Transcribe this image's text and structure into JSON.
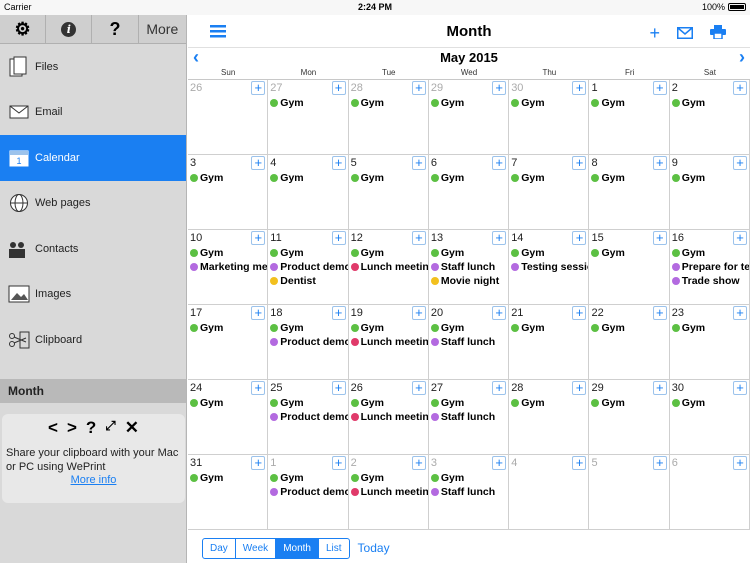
{
  "status": {
    "carrier": "Carrier",
    "time": "2:24 PM",
    "battery": "100%"
  },
  "sidebar": {
    "toolbar": {
      "more_label": "More"
    },
    "items": [
      {
        "label": "Files",
        "icon": "files-icon"
      },
      {
        "label": "Email",
        "icon": "email-icon"
      },
      {
        "label": "Calendar",
        "icon": "calendar-icon"
      },
      {
        "label": "Web pages",
        "icon": "globe-icon"
      },
      {
        "label": "Contacts",
        "icon": "contacts-icon"
      },
      {
        "label": "Images",
        "icon": "images-icon"
      },
      {
        "label": "Clipboard",
        "icon": "clipboard-icon"
      }
    ],
    "active_index": 2,
    "section_header": "Month",
    "clipboard_panel": {
      "text": "Share your clipboard with your Mac or PC using WePrint",
      "link": "More info"
    }
  },
  "header": {
    "title": "Month",
    "month_label": "May 2015"
  },
  "weekdays": [
    "Sun",
    "Mon",
    "Tue",
    "Wed",
    "Thu",
    "Fri",
    "Sat"
  ],
  "colors": {
    "accent": "#1a7ff2",
    "gym": "#5cc043",
    "purple": "#b36ae0",
    "red": "#e03a6a",
    "yellow": "#f2c01e"
  },
  "calendar": {
    "weeks": [
      [
        {
          "day": "26",
          "other": true,
          "events": []
        },
        {
          "day": "27",
          "other": true,
          "events": [
            {
              "t": "Gym",
              "c": "gym"
            }
          ]
        },
        {
          "day": "28",
          "other": true,
          "events": [
            {
              "t": "Gym",
              "c": "gym"
            }
          ]
        },
        {
          "day": "29",
          "other": true,
          "events": [
            {
              "t": "Gym",
              "c": "gym"
            }
          ]
        },
        {
          "day": "30",
          "other": true,
          "events": [
            {
              "t": "Gym",
              "c": "gym"
            }
          ]
        },
        {
          "day": "1",
          "other": false,
          "events": [
            {
              "t": "Gym",
              "c": "gym"
            }
          ]
        },
        {
          "day": "2",
          "other": false,
          "events": [
            {
              "t": "Gym",
              "c": "gym"
            }
          ]
        }
      ],
      [
        {
          "day": "3",
          "events": [
            {
              "t": "Gym",
              "c": "gym"
            }
          ]
        },
        {
          "day": "4",
          "events": [
            {
              "t": "Gym",
              "c": "gym"
            }
          ]
        },
        {
          "day": "5",
          "events": [
            {
              "t": "Gym",
              "c": "gym"
            }
          ]
        },
        {
          "day": "6",
          "events": [
            {
              "t": "Gym",
              "c": "gym"
            }
          ]
        },
        {
          "day": "7",
          "events": [
            {
              "t": "Gym",
              "c": "gym"
            }
          ]
        },
        {
          "day": "8",
          "events": [
            {
              "t": "Gym",
              "c": "gym"
            }
          ]
        },
        {
          "day": "9",
          "events": [
            {
              "t": "Gym",
              "c": "gym"
            }
          ]
        }
      ],
      [
        {
          "day": "10",
          "events": [
            {
              "t": "Gym",
              "c": "gym"
            },
            {
              "t": "Marketing me",
              "c": "purple"
            }
          ]
        },
        {
          "day": "11",
          "events": [
            {
              "t": "Gym",
              "c": "gym"
            },
            {
              "t": "Product demo",
              "c": "purple"
            },
            {
              "t": "Dentist",
              "c": "yellow"
            }
          ]
        },
        {
          "day": "12",
          "events": [
            {
              "t": "Gym",
              "c": "gym"
            },
            {
              "t": "Lunch meetin",
              "c": "red"
            }
          ]
        },
        {
          "day": "13",
          "events": [
            {
              "t": "Gym",
              "c": "gym"
            },
            {
              "t": "Staff lunch",
              "c": "purple"
            },
            {
              "t": "Movie night",
              "c": "yellow"
            }
          ]
        },
        {
          "day": "14",
          "events": [
            {
              "t": "Gym",
              "c": "gym"
            },
            {
              "t": "Testing sessio",
              "c": "purple"
            }
          ]
        },
        {
          "day": "15",
          "events": [
            {
              "t": "Gym",
              "c": "gym"
            }
          ]
        },
        {
          "day": "16",
          "events": [
            {
              "t": "Gym",
              "c": "gym"
            },
            {
              "t": "Prepare for te",
              "c": "purple"
            },
            {
              "t": "Trade show",
              "c": "purple"
            }
          ]
        }
      ],
      [
        {
          "day": "17",
          "events": [
            {
              "t": "Gym",
              "c": "gym"
            }
          ]
        },
        {
          "day": "18",
          "events": [
            {
              "t": "Gym",
              "c": "gym"
            },
            {
              "t": "Product demo",
              "c": "purple"
            }
          ]
        },
        {
          "day": "19",
          "events": [
            {
              "t": "Gym",
              "c": "gym"
            },
            {
              "t": "Lunch meetin",
              "c": "red"
            }
          ]
        },
        {
          "day": "20",
          "events": [
            {
              "t": "Gym",
              "c": "gym"
            },
            {
              "t": "Staff lunch",
              "c": "purple"
            }
          ]
        },
        {
          "day": "21",
          "events": [
            {
              "t": "Gym",
              "c": "gym"
            }
          ]
        },
        {
          "day": "22",
          "events": [
            {
              "t": "Gym",
              "c": "gym"
            }
          ]
        },
        {
          "day": "23",
          "events": [
            {
              "t": "Gym",
              "c": "gym"
            }
          ]
        }
      ],
      [
        {
          "day": "24",
          "events": [
            {
              "t": "Gym",
              "c": "gym"
            }
          ]
        },
        {
          "day": "25",
          "events": [
            {
              "t": "Gym",
              "c": "gym"
            },
            {
              "t": "Product demo",
              "c": "purple"
            }
          ]
        },
        {
          "day": "26",
          "events": [
            {
              "t": "Gym",
              "c": "gym"
            },
            {
              "t": "Lunch meetin",
              "c": "red"
            }
          ]
        },
        {
          "day": "27",
          "events": [
            {
              "t": "Gym",
              "c": "gym"
            },
            {
              "t": "Staff lunch",
              "c": "purple"
            }
          ]
        },
        {
          "day": "28",
          "events": [
            {
              "t": "Gym",
              "c": "gym"
            }
          ]
        },
        {
          "day": "29",
          "events": [
            {
              "t": "Gym",
              "c": "gym"
            }
          ]
        },
        {
          "day": "30",
          "events": [
            {
              "t": "Gym",
              "c": "gym"
            }
          ]
        }
      ],
      [
        {
          "day": "31",
          "events": [
            {
              "t": "Gym",
              "c": "gym"
            }
          ]
        },
        {
          "day": "1",
          "other": true,
          "events": [
            {
              "t": "Gym",
              "c": "gym"
            },
            {
              "t": "Product demo",
              "c": "purple"
            }
          ]
        },
        {
          "day": "2",
          "other": true,
          "events": [
            {
              "t": "Gym",
              "c": "gym"
            },
            {
              "t": "Lunch meetin",
              "c": "red"
            }
          ]
        },
        {
          "day": "3",
          "other": true,
          "events": [
            {
              "t": "Gym",
              "c": "gym"
            },
            {
              "t": "Staff lunch",
              "c": "purple"
            }
          ]
        },
        {
          "day": "4",
          "other": true,
          "events": []
        },
        {
          "day": "5",
          "other": true,
          "events": []
        },
        {
          "day": "6",
          "other": true,
          "events": []
        }
      ]
    ]
  },
  "bottom": {
    "views": [
      "Day",
      "Week",
      "Month",
      "List"
    ],
    "active_view": 2,
    "today": "Today"
  }
}
